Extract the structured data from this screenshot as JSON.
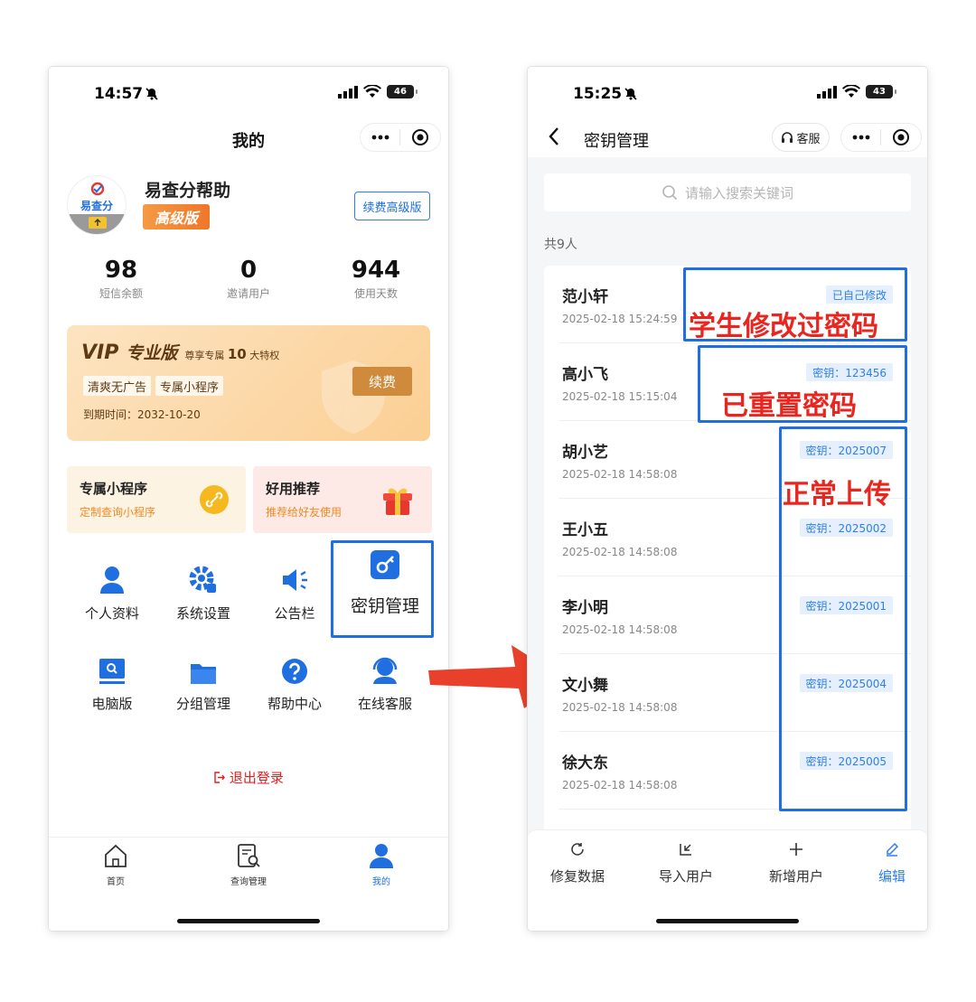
{
  "left": {
    "status": {
      "time": "14:57",
      "battery": "46"
    },
    "title": "我的",
    "user": {
      "name": "易查分帮助",
      "avatar_text": "易查分",
      "badge": "高级版",
      "renew_advanced": "续费高级版"
    },
    "stats": [
      {
        "value": "98",
        "label": "短信余额"
      },
      {
        "value": "0",
        "label": "邀请用户"
      },
      {
        "value": "944",
        "label": "使用天数"
      }
    ],
    "vip": {
      "logo": "VIP",
      "title": "专业版",
      "sub_prefix": "尊享专属",
      "sub_num": "10",
      "sub_suffix": "大特权",
      "tags": [
        "清爽无广告",
        "专属小程序"
      ],
      "expire": "到期时间：2032-10-20",
      "renew": "续费"
    },
    "promos": [
      {
        "title": "专属小程序",
        "sub": "定制查询小程序"
      },
      {
        "title": "好用推荐",
        "sub": "推荐给好友使用"
      }
    ],
    "grid": [
      {
        "label": "个人资料",
        "icon": "person-icon"
      },
      {
        "label": "系统设置",
        "icon": "gear-icon"
      },
      {
        "label": "公告栏",
        "icon": "megaphone-icon"
      },
      {
        "label": "密钥管理",
        "icon": "key-icon"
      },
      {
        "label": "电脑版",
        "icon": "monitor-icon"
      },
      {
        "label": "分组管理",
        "icon": "folder-icon"
      },
      {
        "label": "帮助中心",
        "icon": "help-icon"
      },
      {
        "label": "在线客服",
        "icon": "headset-icon"
      }
    ],
    "logout": "退出登录",
    "tabs": [
      {
        "label": "首页",
        "icon": "home-icon"
      },
      {
        "label": "查询管理",
        "icon": "query-icon"
      },
      {
        "label": "我的",
        "icon": "user-icon"
      }
    ]
  },
  "right": {
    "status": {
      "time": "15:25",
      "battery": "43"
    },
    "title": "密钥管理",
    "kefu": "客服",
    "search_placeholder": "请输入搜索关键词",
    "count": "共9人",
    "rows": [
      {
        "name": "范小轩",
        "time": "2025-02-18 15:24:59",
        "badge": "已自己修改"
      },
      {
        "name": "高小飞",
        "time": "2025-02-18 15:15:04",
        "badge": "密钥：123456"
      },
      {
        "name": "胡小艺",
        "time": "2025-02-18 14:58:08",
        "badge": "密钥：2025007"
      },
      {
        "name": "王小五",
        "time": "2025-02-18 14:58:08",
        "badge": "密钥：2025002"
      },
      {
        "name": "李小明",
        "time": "2025-02-18 14:58:08",
        "badge": "密钥：2025001"
      },
      {
        "name": "文小舞",
        "time": "2025-02-18 14:58:08",
        "badge": "密钥：2025004"
      },
      {
        "name": "徐大东",
        "time": "2025-02-18 14:58:08",
        "badge": "密钥：2025005"
      }
    ],
    "actions": [
      {
        "label": "修复数据",
        "icon": "refresh-icon"
      },
      {
        "label": "导入用户",
        "icon": "import-icon"
      },
      {
        "label": "新增用户",
        "icon": "plus-icon"
      },
      {
        "label": "编辑",
        "icon": "edit-icon"
      }
    ]
  },
  "annotations": {
    "student_modified": "学生修改过密码",
    "reset": "已重置密码",
    "normal": "正常上传"
  },
  "colors": {
    "brand_blue": "#1f6fe0",
    "annotation_red": "#e8251e",
    "arrow_red": "#e8402a"
  }
}
